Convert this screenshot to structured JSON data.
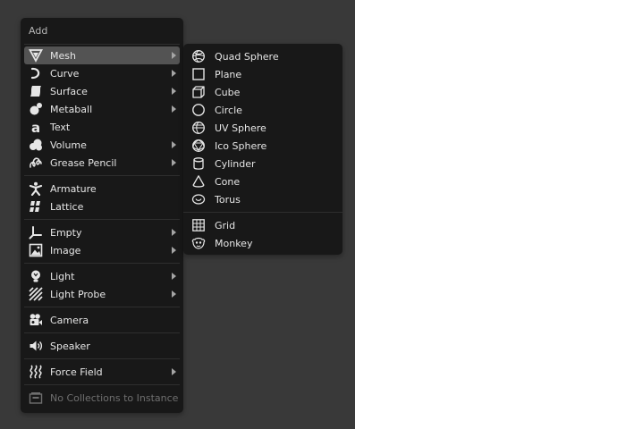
{
  "menu": {
    "title": "Add",
    "groups": [
      [
        {
          "label": "Mesh",
          "icon": "mesh-icon",
          "submenu": true,
          "active": true
        },
        {
          "label": "Curve",
          "icon": "curve-icon",
          "submenu": true
        },
        {
          "label": "Surface",
          "icon": "surface-icon",
          "submenu": true
        },
        {
          "label": "Metaball",
          "icon": "metaball-icon",
          "submenu": true
        },
        {
          "label": "Text",
          "icon": "text-icon",
          "submenu": false
        },
        {
          "label": "Volume",
          "icon": "volume-icon",
          "submenu": true
        },
        {
          "label": "Grease Pencil",
          "icon": "grease-pencil-icon",
          "submenu": true
        }
      ],
      [
        {
          "label": "Armature",
          "icon": "armature-icon",
          "submenu": false
        },
        {
          "label": "Lattice",
          "icon": "lattice-icon",
          "submenu": false
        }
      ],
      [
        {
          "label": "Empty",
          "icon": "empty-icon",
          "submenu": true
        },
        {
          "label": "Image",
          "icon": "image-icon",
          "submenu": true
        }
      ],
      [
        {
          "label": "Light",
          "icon": "light-icon",
          "submenu": true
        },
        {
          "label": "Light Probe",
          "icon": "light-probe-icon",
          "submenu": true
        }
      ],
      [
        {
          "label": "Camera",
          "icon": "camera-icon",
          "submenu": false
        }
      ],
      [
        {
          "label": "Speaker",
          "icon": "speaker-icon",
          "submenu": false
        }
      ],
      [
        {
          "label": "Force Field",
          "icon": "force-field-icon",
          "submenu": true
        }
      ],
      [
        {
          "label": "No Collections to Instance",
          "icon": "collection-icon",
          "submenu": false,
          "disabled": true
        }
      ]
    ]
  },
  "submenu": {
    "groups": [
      [
        {
          "label": "Quad Sphere",
          "icon": "quad-sphere-icon"
        },
        {
          "label": "Plane",
          "icon": "plane-icon"
        },
        {
          "label": "Cube",
          "icon": "cube-icon"
        },
        {
          "label": "Circle",
          "icon": "circle-icon"
        },
        {
          "label": "UV Sphere",
          "icon": "uv-sphere-icon"
        },
        {
          "label": "Ico Sphere",
          "icon": "ico-sphere-icon"
        },
        {
          "label": "Cylinder",
          "icon": "cylinder-icon"
        },
        {
          "label": "Cone",
          "icon": "cone-icon"
        },
        {
          "label": "Torus",
          "icon": "torus-icon"
        }
      ],
      [
        {
          "label": "Grid",
          "icon": "grid-icon"
        },
        {
          "label": "Monkey",
          "icon": "monkey-icon"
        }
      ]
    ]
  },
  "colors": {
    "viewport": "#393939",
    "menu_bg": "#181818",
    "active_item": "#535353",
    "text": "#e6e6e6",
    "disabled_text": "#6f6f6f"
  }
}
